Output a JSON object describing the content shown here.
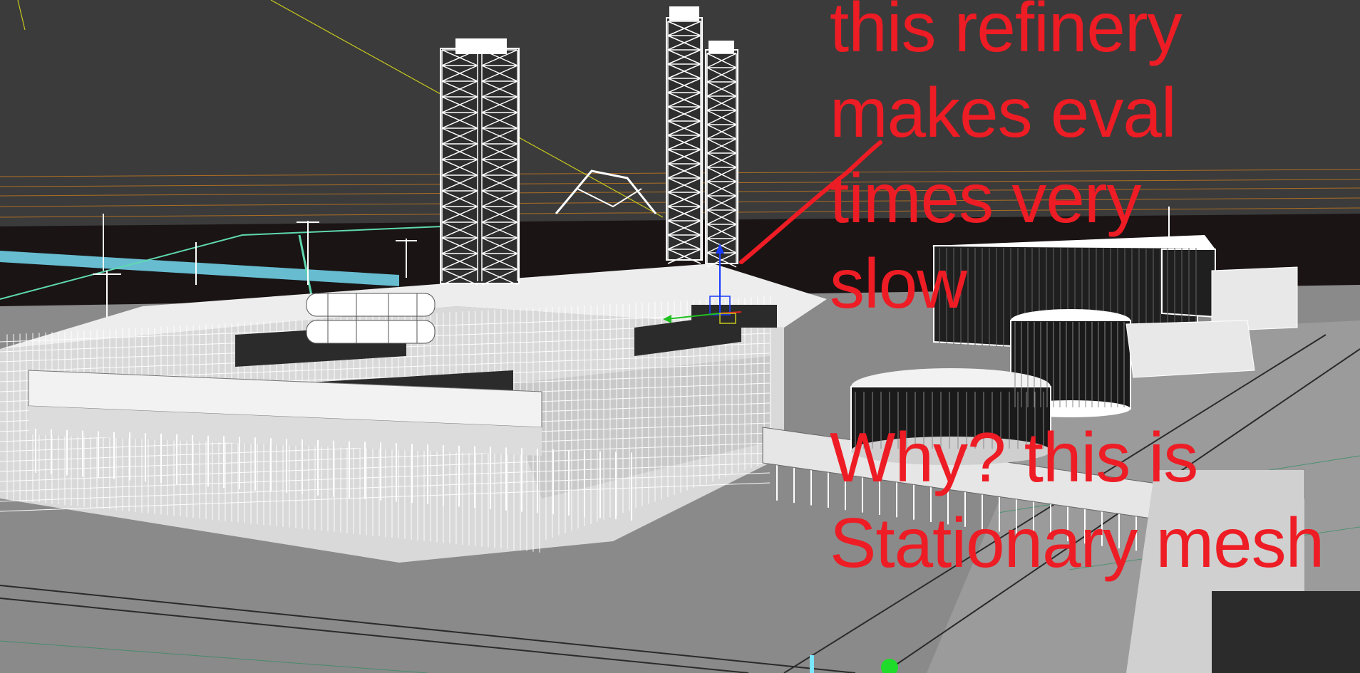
{
  "viewport": {
    "background_color": "#3b3b3b",
    "wireframe_color": "#ffffff",
    "ground_color": "#8a8a8a",
    "annotation_color": "#ee1c24",
    "gizmo_colors": {
      "z_axis": "#1a3cff",
      "x_axis": "#e02020",
      "y_axis": "#20c020"
    }
  },
  "annotations": {
    "top": [
      "this refinery",
      "makes eval",
      "times very",
      "slow"
    ],
    "bottom": [
      "Why? this is",
      "Stationary mesh"
    ]
  }
}
